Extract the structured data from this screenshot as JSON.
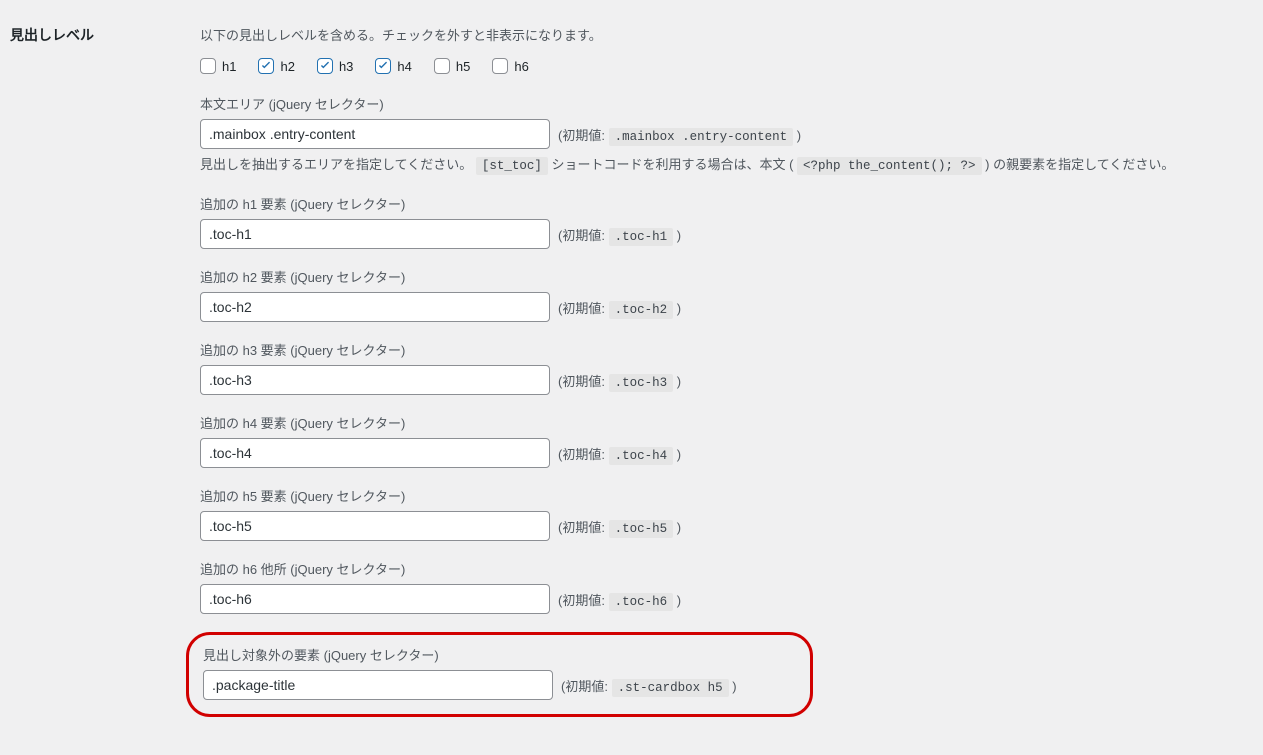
{
  "section": {
    "title": "見出しレベル",
    "description": "以下の見出しレベルを含める。チェックを外すと非表示になります。"
  },
  "checkbox": {
    "h1": {
      "label": "h1",
      "checked": false
    },
    "h2": {
      "label": "h2",
      "checked": true
    },
    "h3": {
      "label": "h3",
      "checked": true
    },
    "h4": {
      "label": "h4",
      "checked": true
    },
    "h5": {
      "label": "h5",
      "checked": false
    },
    "h6": {
      "label": "h6",
      "checked": false
    }
  },
  "content_area": {
    "label": "本文エリア (jQuery セレクター)",
    "value": ".mainbox .entry-content",
    "default_prefix": "(初期値: ",
    "default_value": ".mainbox .entry-content",
    "default_suffix": " )",
    "help_prefix": "見出しを抽出するエリアを指定してください。 ",
    "help_code1": "[st_toc]",
    "help_mid": " ショートコードを利用する場合は、本文 ( ",
    "help_code2": "<?php the_content(); ?>",
    "help_suffix": " ) の親要素を指定してください。"
  },
  "addh1": {
    "label": "追加の h1 要素 (jQuery セレクター)",
    "value": ".toc-h1",
    "default_prefix": "(初期値: ",
    "default_value": ".toc-h1",
    "default_suffix": " )"
  },
  "addh2": {
    "label": "追加の h2 要素 (jQuery セレクター)",
    "value": ".toc-h2",
    "default_prefix": "(初期値: ",
    "default_value": ".toc-h2",
    "default_suffix": " )"
  },
  "addh3": {
    "label": "追加の h3 要素 (jQuery セレクター)",
    "value": ".toc-h3",
    "default_prefix": "(初期値: ",
    "default_value": ".toc-h3",
    "default_suffix": " )"
  },
  "addh4": {
    "label": "追加の h4 要素 (jQuery セレクター)",
    "value": ".toc-h4",
    "default_prefix": "(初期値: ",
    "default_value": ".toc-h4",
    "default_suffix": " )"
  },
  "addh5": {
    "label": "追加の h5 要素 (jQuery セレクター)",
    "value": ".toc-h5",
    "default_prefix": "(初期値: ",
    "default_value": ".toc-h5",
    "default_suffix": " )"
  },
  "addh6": {
    "label": "追加の h6 他所 (jQuery セレクター)",
    "value": ".toc-h6",
    "default_prefix": "(初期値: ",
    "default_value": ".toc-h6",
    "default_suffix": " )"
  },
  "exclude": {
    "label": "見出し対象外の要素 (jQuery セレクター)",
    "value": ".package-title",
    "default_prefix": "(初期値: ",
    "default_value": ".st-cardbox h5",
    "default_suffix": " )"
  }
}
